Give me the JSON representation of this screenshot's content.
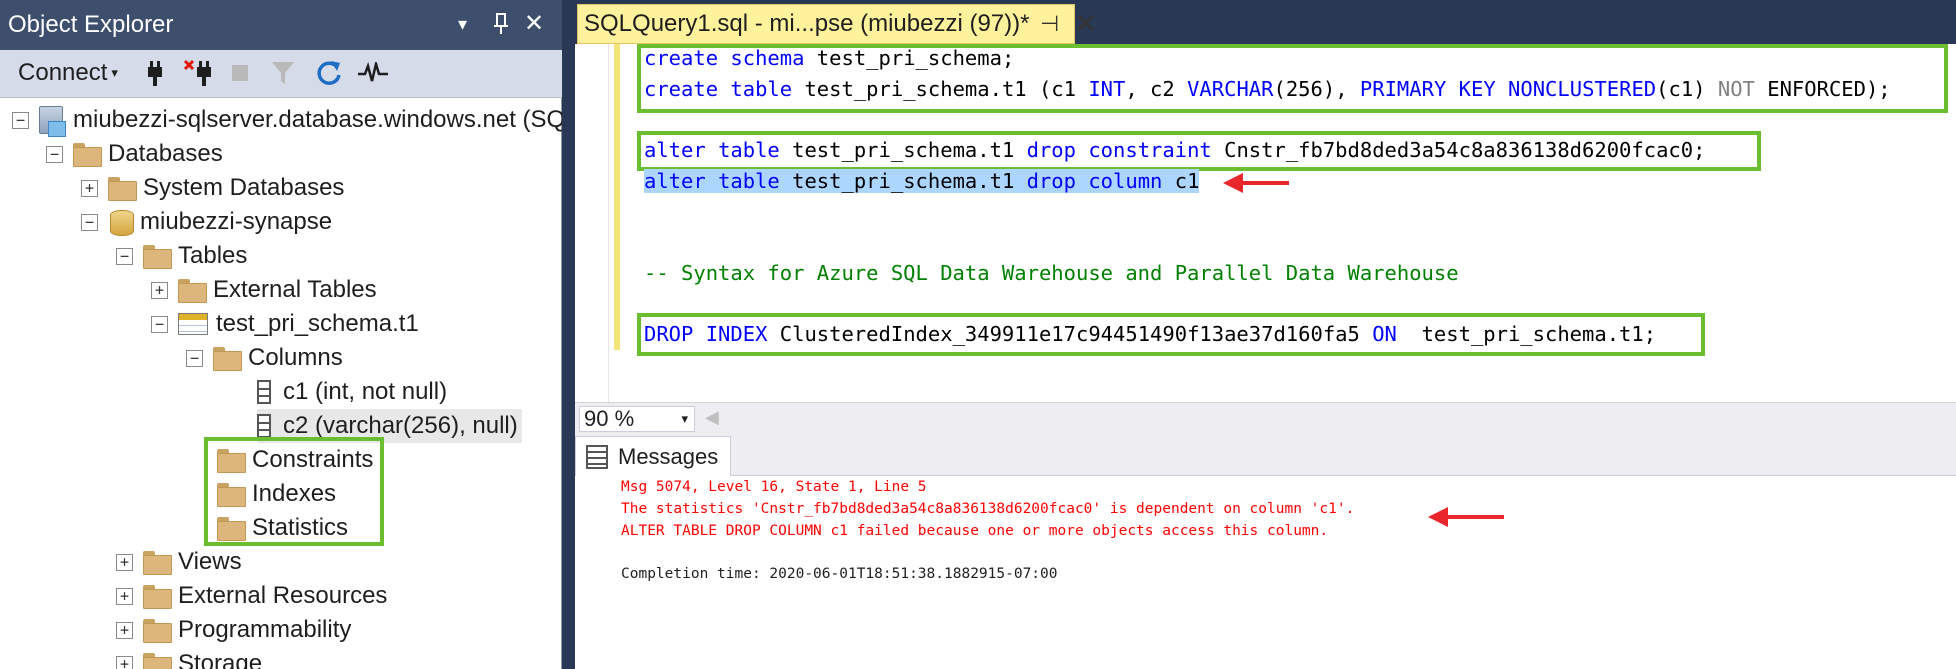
{
  "object_explorer": {
    "title": "Object Explorer",
    "title_buttons": [
      "▾",
      "📌",
      "✕"
    ],
    "toolbar": {
      "connect_label": "Connect",
      "connect_arrow": "▾",
      "icons": [
        "connect-plug-icon",
        "disconnect-plug-icon",
        "stop-icon",
        "filter-icon",
        "refresh-icon",
        "activity-monitor-icon"
      ]
    },
    "tree": {
      "server": "miubezzi-sqlserver.database.windows.net (SQ",
      "databases": "Databases",
      "system_databases": "System Databases",
      "database": "miubezzi-synapse",
      "tables": "Tables",
      "external_tables": "External Tables",
      "table": "test_pri_schema.t1",
      "columns": "Columns",
      "column_1": "c1 (int, not null)",
      "column_2": "c2 (varchar(256), null)",
      "constraints": "Constraints",
      "indexes": "Indexes",
      "statistics": "Statistics",
      "views": "Views",
      "external_resources": "External Resources",
      "programmability": "Programmability",
      "storage": "Storage"
    },
    "expanders": {
      "expanded": "−",
      "collapsed": "+"
    }
  },
  "editor": {
    "tab_title": "SQLQuery1.sql - mi...pse (miubezzi (97))*",
    "tab_pin": "⊣",
    "tab_close": "✕",
    "code": {
      "l1": [
        "create",
        " ",
        "schema",
        " test_pri_schema;"
      ],
      "l2": [
        "create",
        " ",
        "table",
        " test_pri_schema.t1 (c1 ",
        "INT",
        ", c2 ",
        "VARCHAR",
        "(256), ",
        "PRIMARY",
        " ",
        "KEY",
        " ",
        "NONCLUSTERED",
        "(c1) ",
        "NOT",
        " ENFORCED);"
      ],
      "l3": [
        "alter",
        " ",
        "table",
        " test_pri_schema.t1 ",
        "drop",
        " ",
        "constraint",
        " Cnstr_fb7bd8ded3a54c8a836138d6200fcac0;"
      ],
      "l4": [
        "alter",
        " ",
        "table",
        " test_pri_schema.t1 ",
        "drop",
        " ",
        "column",
        " c1"
      ],
      "comment": "-- Syntax for Azure SQL Data Warehouse and Parallel Data Warehouse",
      "l6": [
        "DROP",
        " ",
        "INDEX",
        " ClusteredIndex_349911e17c94451490f13ae37d160fa5 ",
        "ON",
        "  test_pri_schema.t1;"
      ]
    },
    "zoom": "90 %",
    "zoom_arrow": "▾",
    "zoom_scroll_left": "◀"
  },
  "results": {
    "tab_label": "Messages",
    "lines": [
      "Msg 5074, Level 16, State 1, Line 5",
      "The statistics 'Cnstr_fb7bd8ded3a54c8a836138d6200fcac0' is dependent on column 'c1'.",
      "ALTER TABLE DROP COLUMN c1 failed because one or more objects access this column."
    ],
    "completion": "Completion time: 2020-06-01T18:51:38.1882915-07:00"
  },
  "colors": {
    "highlight_box": "#6abe2f",
    "arrow": "#e8262b",
    "error_text": "#ff0000",
    "keyword": "#0000ff",
    "comment": "#008000"
  }
}
